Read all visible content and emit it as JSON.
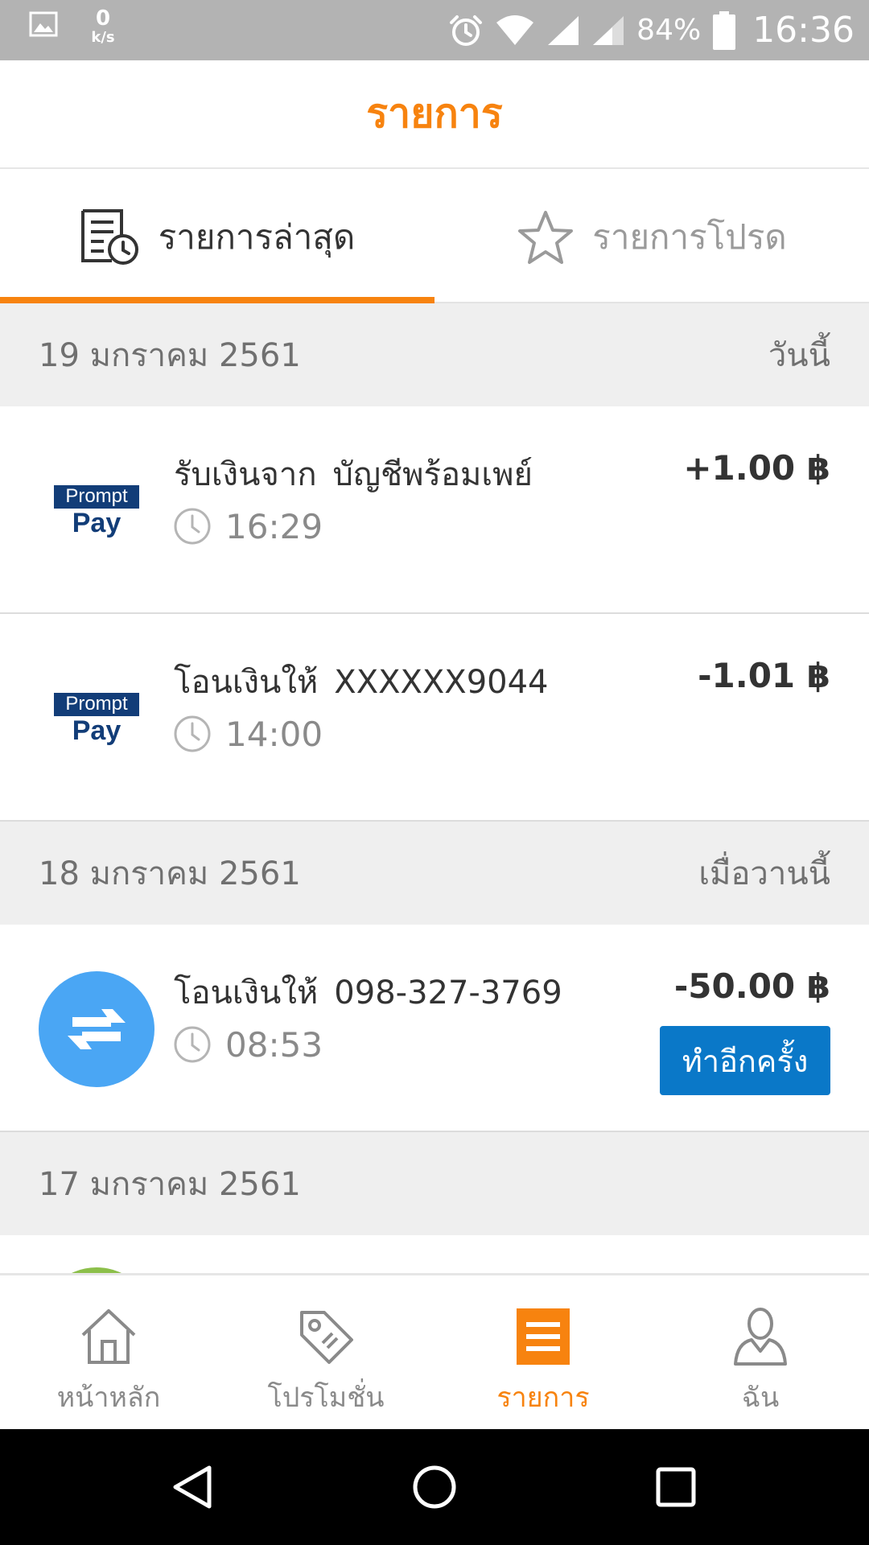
{
  "status_bar": {
    "net_speed_value": "0",
    "net_speed_unit": "k/s",
    "battery_pct": "84%",
    "time": "16:36"
  },
  "header": {
    "title": "รายการ"
  },
  "tabs": [
    {
      "label": "รายการล่าสุด",
      "icon": "receipt-clock-icon",
      "active": true
    },
    {
      "label": "รายการโปรด",
      "icon": "star-icon",
      "active": false
    }
  ],
  "groups": [
    {
      "date": "19 มกราคม 2561",
      "relative": "วันนี้",
      "items": [
        {
          "logo": "promptpay-logo",
          "action": "รับเงินจาก",
          "target": "บัญชีพร้อมเพย์",
          "time": "16:29",
          "amount": "+1.00 ฿"
        },
        {
          "logo": "promptpay-logo",
          "action": "โอนเงินให้",
          "target": "XXXXXX9044",
          "time": "14:00",
          "amount": "-1.01 ฿"
        }
      ]
    },
    {
      "date": "18 มกราคม 2561",
      "relative": "เมื่อวานนี้",
      "items": [
        {
          "logo": "transfer-icon",
          "action": "โอนเงินให้",
          "target": "098-327-3769",
          "time": "08:53",
          "amount": "-50.00 ฿",
          "button": "ทำอีกครั้ง"
        }
      ]
    },
    {
      "date": "17 มกราคม 2561",
      "relative": ""
    }
  ],
  "promptpay_logo": {
    "top": "Prompt",
    "bottom": "Pay"
  },
  "bottom_nav": [
    {
      "label": "หน้าหลัก",
      "icon": "home-icon",
      "active": false
    },
    {
      "label": "โปรโมชั่น",
      "icon": "tag-icon",
      "active": false
    },
    {
      "label": "รายการ",
      "icon": "list-icon",
      "active": true
    },
    {
      "label": "ฉัน",
      "icon": "user-icon",
      "active": false
    }
  ],
  "colors": {
    "accent": "#f7830f",
    "button_blue": "#0a78c8",
    "transfer_circle": "#4aa6f4",
    "promptpay_navy": "#123d78"
  }
}
